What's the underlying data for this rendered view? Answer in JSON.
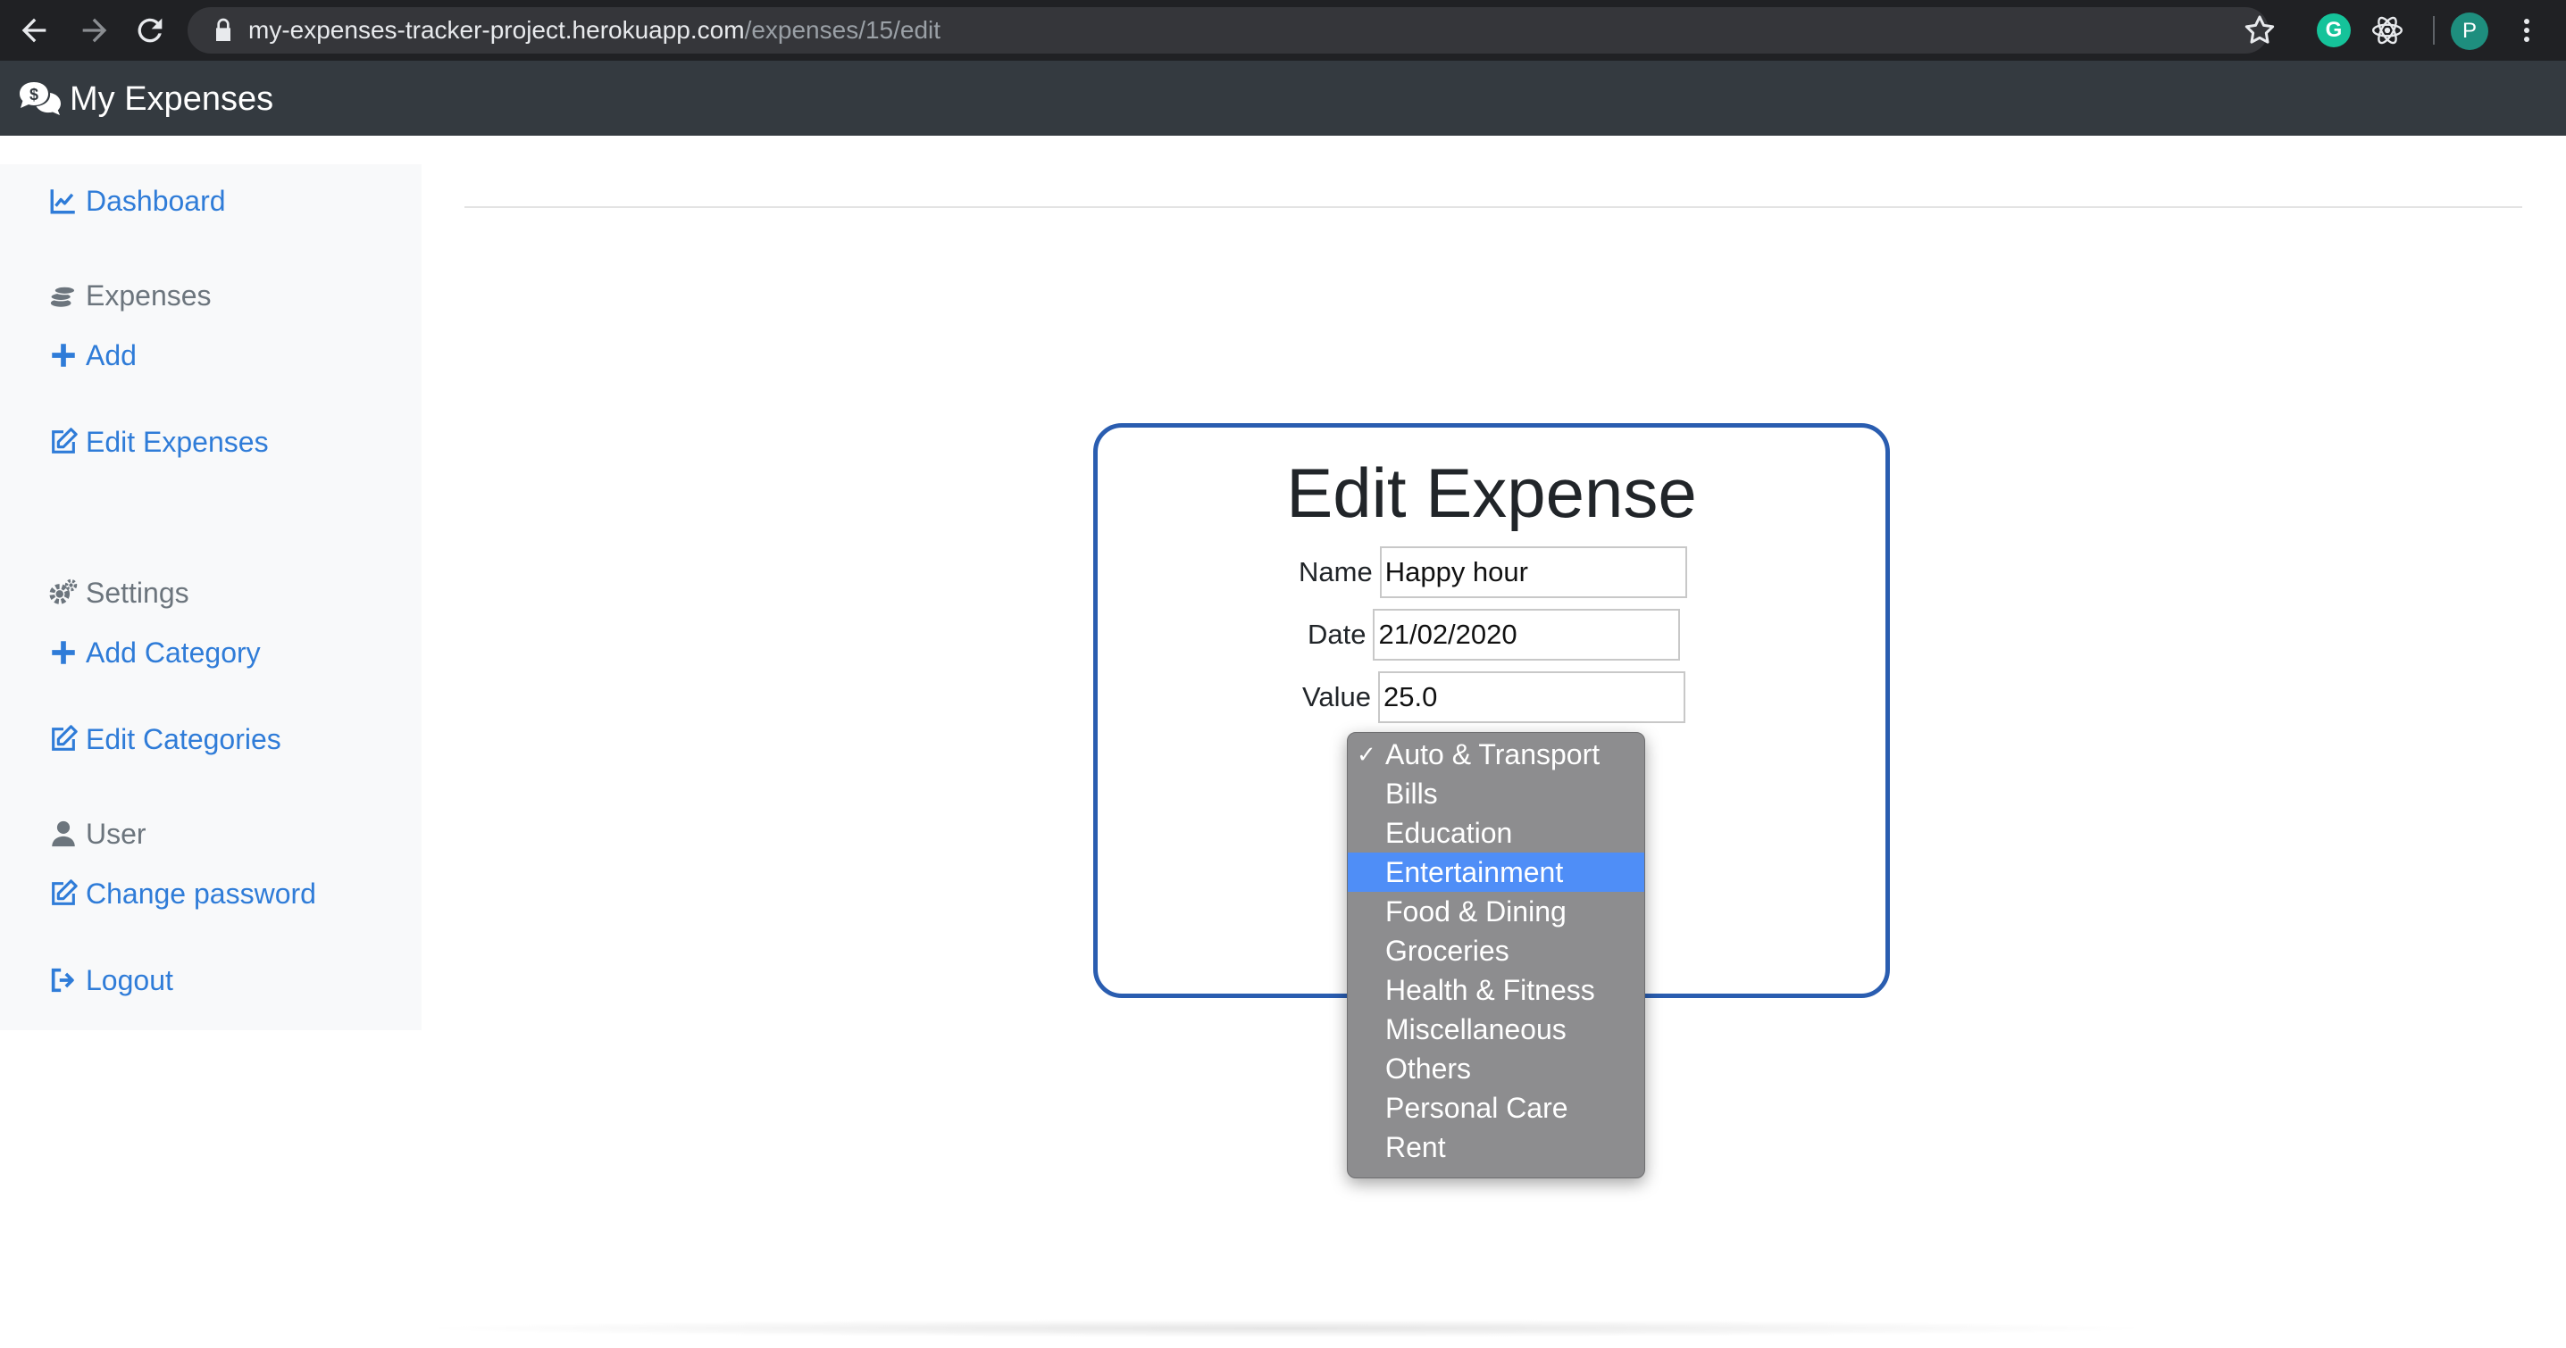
{
  "browser": {
    "url_host": "my-expenses-tracker-project.herokuapp.com",
    "url_path": "/expenses/15/edit",
    "extension_g_label": "G",
    "profile_initial": "P",
    "icons": {
      "back": "back-arrow-icon",
      "forward": "forward-arrow-icon",
      "reload": "reload-icon",
      "lock": "lock-icon",
      "bookmark": "star-icon",
      "extension_1": "grammarly-icon",
      "extension_2": "react-devtools-icon",
      "menu": "kebab-menu-icon"
    }
  },
  "navbar": {
    "brand": "My Expenses",
    "brand_icon": "money-chat-icon",
    "background": "#343a40"
  },
  "sidebar": {
    "dashboard": "Dashboard",
    "expenses_heading": "Expenses",
    "add": "Add",
    "edit_expenses": "Edit Expenses",
    "settings_heading": "Settings",
    "add_category": "Add Category",
    "edit_categories": "Edit Categories",
    "user_heading": "User",
    "change_password": "Change password",
    "logout": "Logout",
    "link_color": "#2f7cd8"
  },
  "form": {
    "title": "Edit Expense",
    "name_label": "Name",
    "name_value": "Happy hour",
    "date_label": "Date",
    "date_value": "21/02/2020",
    "value_label": "Value",
    "value_value": "25.0",
    "border_color": "#2a5db0"
  },
  "category_dropdown": {
    "checkmark": "✓",
    "options": [
      "Auto & Transport",
      "Bills",
      "Education",
      "Entertainment",
      "Food & Dining",
      "Groceries",
      "Health & Fitness",
      "Miscellaneous",
      "Others",
      "Personal Care",
      "Rent"
    ],
    "selected": "Auto & Transport",
    "highlighted": "Entertainment",
    "highlight_color": "#4f8ef7"
  }
}
